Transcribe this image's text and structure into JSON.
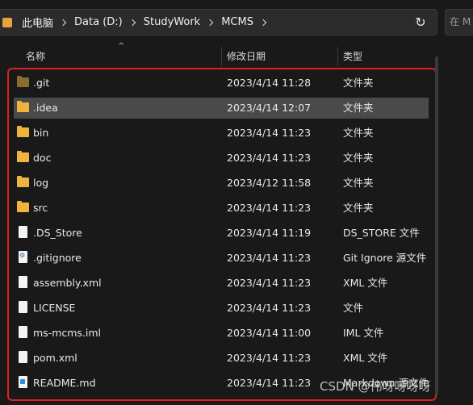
{
  "breadcrumb": [
    "此电脑",
    "Data (D:)",
    "StudyWork",
    "MCMS"
  ],
  "search": {
    "placeholder": "在 M"
  },
  "columns": {
    "name": "名称",
    "date": "修改日期",
    "type": "类型"
  },
  "files": [
    {
      "icon": "folder-icon",
      "name": ".git",
      "date": "2023/4/14 11:28",
      "type": "文件夹"
    },
    {
      "icon": "folder-icon",
      "name": ".idea",
      "date": "2023/4/14 12:07",
      "type": "文件夹"
    },
    {
      "icon": "folder-icon",
      "name": "bin",
      "date": "2023/4/14 11:23",
      "type": "文件夹"
    },
    {
      "icon": "folder-icon",
      "name": "doc",
      "date": "2023/4/14 11:23",
      "type": "文件夹"
    },
    {
      "icon": "folder-icon",
      "name": "log",
      "date": "2023/4/12 11:58",
      "type": "文件夹"
    },
    {
      "icon": "folder-icon",
      "name": "src",
      "date": "2023/4/14 11:23",
      "type": "文件夹"
    },
    {
      "icon": "file-icon",
      "name": ".DS_Store",
      "date": "2023/4/14 11:19",
      "type": "DS_STORE 文件"
    },
    {
      "icon": "settings-file-icon",
      "name": ".gitignore",
      "date": "2023/4/14 11:23",
      "type": "Git Ignore 源文件"
    },
    {
      "icon": "file-icon",
      "name": "assembly.xml",
      "date": "2023/4/14 11:23",
      "type": "XML 文件"
    },
    {
      "icon": "file-icon",
      "name": "LICENSE",
      "date": "2023/4/14 11:23",
      "type": "文件"
    },
    {
      "icon": "file-icon",
      "name": "ms-mcms.iml",
      "date": "2023/4/14 11:00",
      "type": "IML 文件"
    },
    {
      "icon": "file-icon",
      "name": "pom.xml",
      "date": "2023/4/14 11:23",
      "type": "XML 文件"
    },
    {
      "icon": "markdown-file-icon",
      "name": "README.md",
      "date": "2023/4/14 11:23",
      "type": "Markdown 源文件"
    }
  ],
  "watermark": "CSDN @伟呀呀呀呀"
}
